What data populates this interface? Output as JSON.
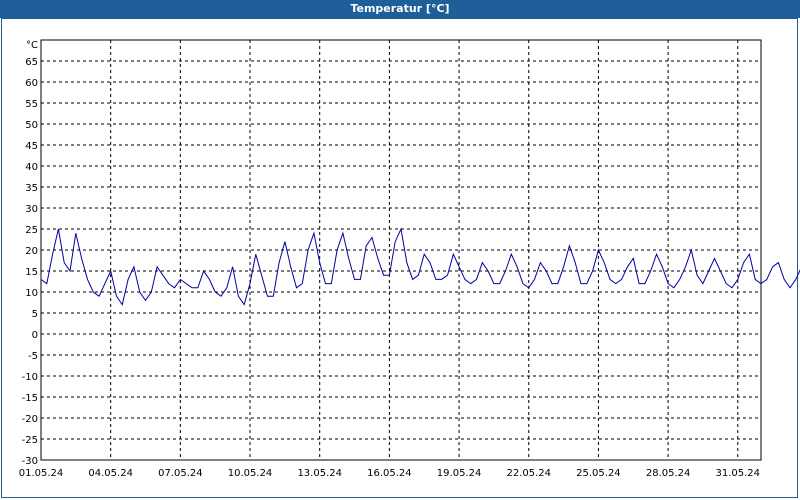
{
  "title": "Temperatur [°C]",
  "chart_data": {
    "type": "line",
    "title": "Temperatur [°C]",
    "ylabel": "°C",
    "xlabel": "",
    "ylim": [
      -30,
      70
    ],
    "yticks": [
      65,
      60,
      55,
      50,
      45,
      40,
      35,
      30,
      25,
      20,
      15,
      10,
      5,
      0,
      -5,
      -10,
      -15,
      -20,
      -25,
      -30
    ],
    "xlim": [
      "01.05.24",
      "01.06.24"
    ],
    "xtick_labels": [
      "01.05.24",
      "04.05.24",
      "07.05.24",
      "10.05.24",
      "13.05.24",
      "16.05.24",
      "19.05.24",
      "22.05.24",
      "25.05.24",
      "28.05.24",
      "31.05.24"
    ],
    "grid": true,
    "line_color": "#0000a0",
    "series": [
      {
        "x_start": "01.05.24",
        "x_step_days": 0.25,
        "values": [
          13,
          12,
          19,
          25,
          17,
          15,
          24,
          18,
          13,
          10,
          9,
          12,
          15,
          9,
          7,
          13,
          16,
          10,
          8,
          10,
          16,
          14,
          12,
          11,
          13,
          12,
          11,
          11,
          15,
          13,
          10,
          9,
          11,
          16,
          9,
          7,
          12,
          19,
          14,
          9,
          9,
          17,
          22,
          16,
          11,
          12,
          20,
          24,
          17,
          12,
          12,
          20,
          24,
          18,
          13,
          13,
          21,
          23,
          18,
          14,
          14,
          22,
          25,
          17,
          13,
          14,
          19,
          17,
          13,
          13,
          14,
          19,
          16,
          13,
          12,
          13,
          17,
          15,
          12,
          12,
          15,
          19,
          16,
          12,
          11,
          13,
          17,
          15,
          12,
          12,
          16,
          21,
          17,
          12,
          12,
          15,
          20,
          17,
          13,
          12,
          13,
          16,
          18,
          12,
          12,
          15,
          19,
          16,
          12,
          11,
          13,
          16,
          20,
          14,
          12,
          15,
          18,
          15,
          12,
          11,
          13,
          17,
          19,
          13,
          12,
          13,
          16,
          17,
          13,
          11,
          13,
          16,
          21,
          18,
          13,
          11,
          14,
          18,
          16,
          12,
          11,
          14,
          17,
          16,
          12,
          12,
          14,
          18,
          16,
          11,
          11,
          14,
          18,
          17,
          12,
          11,
          13,
          16,
          17,
          13,
          11,
          13,
          17,
          16,
          13,
          11,
          13,
          17,
          17
        ]
      }
    ]
  }
}
